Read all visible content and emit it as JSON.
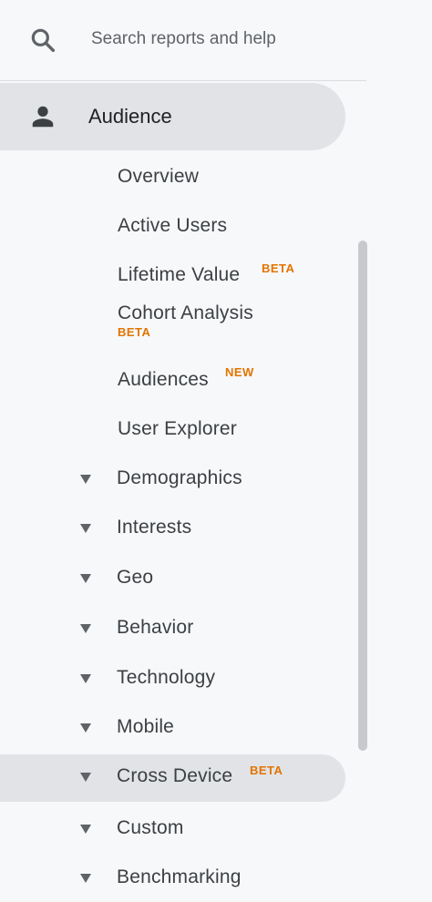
{
  "search": {
    "placeholder": "Search reports and help",
    "icon": "search-icon"
  },
  "audience": {
    "label": "Audience",
    "icon": "person-icon"
  },
  "sub_items": [
    {
      "label": "Overview",
      "badge": ""
    },
    {
      "label": "Active Users",
      "badge": ""
    },
    {
      "label": "Lifetime Value",
      "badge": "BETA"
    },
    {
      "label": "Cohort Analysis",
      "badge": "BETA"
    },
    {
      "label": "Audiences",
      "badge": "NEW"
    },
    {
      "label": "User Explorer",
      "badge": ""
    }
  ],
  "expandable_items": [
    {
      "label": "Demographics",
      "badge": ""
    },
    {
      "label": "Interests",
      "badge": ""
    },
    {
      "label": "Geo",
      "badge": ""
    },
    {
      "label": "Behavior",
      "badge": ""
    },
    {
      "label": "Technology",
      "badge": ""
    },
    {
      "label": "Mobile",
      "badge": ""
    },
    {
      "label": "Cross Device",
      "badge": "BETA",
      "selected": true
    },
    {
      "label": "Custom",
      "badge": ""
    },
    {
      "label": "Benchmarking",
      "badge": ""
    }
  ],
  "colors": {
    "background": "#f7f8fa",
    "selected_bg": "#e1e3e6",
    "badge": "#e37400",
    "text": "#3c4043",
    "icon": "#5f6368"
  }
}
